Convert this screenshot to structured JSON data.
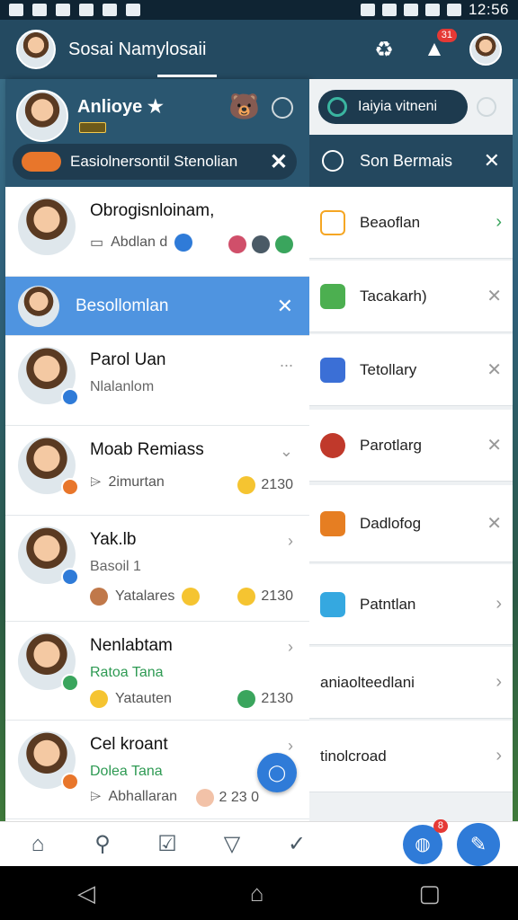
{
  "status_bar": {
    "time": "12:56"
  },
  "app_bar": {
    "title": "Sosai Namylosaii",
    "notification_count": "31"
  },
  "drawer": {
    "user": {
      "name": "Anlioye",
      "star": "★"
    },
    "notice": {
      "text": "Easiolnersontil Stenolian",
      "close": "✕"
    },
    "rows": [
      {
        "title": "Obrogisnloinam,",
        "sub": "Abdlan d",
        "type": "plain"
      },
      {
        "title": "Besollomlan",
        "type": "active",
        "close": "✕"
      },
      {
        "title": "Parol Uan",
        "sub": "Nlalanlom",
        "right": "...",
        "type": "plain"
      },
      {
        "title": "Moab Remiass",
        "sub": "2imurtan",
        "count": "2130",
        "right": "⌄",
        "type": "plain"
      },
      {
        "title": "Yak.lb",
        "sub": "Basoil 1",
        "meta": "Yatalares",
        "count": "2130",
        "right": "›",
        "type": "plain"
      },
      {
        "title": "Nenlabtam",
        "sub": "Ratoa Tana",
        "meta": "Yatauten",
        "count": "2130",
        "right": "›",
        "type": "green"
      },
      {
        "title": "Cel kroant",
        "sub": "Dolea Tana",
        "meta": "Abhallaran",
        "count": "2 23 0",
        "right": "›",
        "type": "green"
      }
    ]
  },
  "panel": {
    "search": {
      "label": "Iaiyia vitneni"
    },
    "header": {
      "label": "Son Bermais",
      "close": "✕"
    },
    "items": [
      {
        "label": "Beaoflan",
        "action": "›",
        "icon_color": "#f5a623"
      },
      {
        "label": "Tacakarh)",
        "action": "✕",
        "icon_color": "#4caf50"
      },
      {
        "label": "Tetollary",
        "action": "✕",
        "icon_color": "#3b6fd6"
      },
      {
        "label": "Parotlarg",
        "action": "✕",
        "icon_color": "#c0392b"
      },
      {
        "label": "Dadlofog",
        "action": "✕",
        "icon_color": "#e67e22"
      },
      {
        "label": "Patntlan",
        "action": "›",
        "icon_color": "#35a8e0"
      },
      {
        "label": "aniaolteedlani",
        "action": "›",
        "icon_color": "#ffffff"
      },
      {
        "label": "tinolcroad",
        "action": "›",
        "icon_color": "#ffffff"
      }
    ]
  },
  "bottom_nav": {
    "badge": "8"
  },
  "icons": {
    "home": "home-icon",
    "search": "search-icon",
    "inbox": "inbox-icon",
    "filter": "filter-icon",
    "task": "task-icon",
    "globe": "globe-icon",
    "edit": "edit-icon"
  }
}
